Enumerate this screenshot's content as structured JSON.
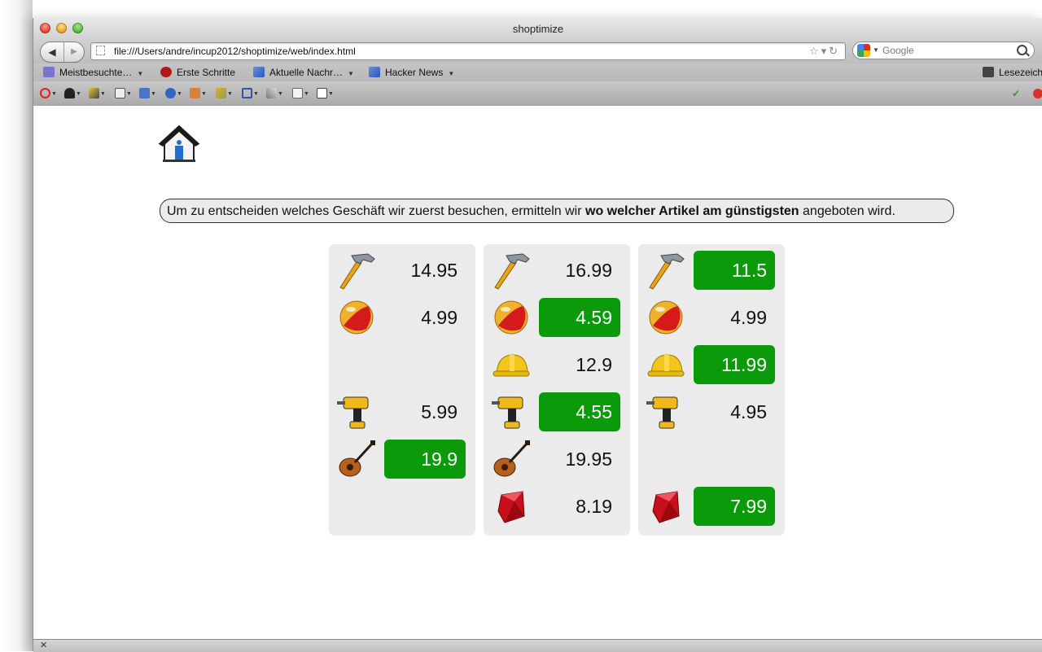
{
  "window": {
    "title": "shoptimize"
  },
  "nav": {
    "url": "file:///Users/andre/incup2012/shoptimize/web/index.html",
    "search_placeholder": "Google"
  },
  "bookmarks": [
    {
      "label": "Meistbesuchte…",
      "icon": "star-folder-icon"
    },
    {
      "label": "Erste Schritte",
      "icon": "firefox-icon"
    },
    {
      "label": "Aktuelle Nachr…",
      "icon": "rss-icon"
    },
    {
      "label": "Hacker News",
      "icon": "rss-icon"
    },
    {
      "label": "Lesezeich",
      "icon": "bookmarks-icon"
    }
  ],
  "page": {
    "info_prefix": "Um zu entscheiden welches Geschäft wir zuerst besuchen, ermitteln wir ",
    "info_bold": "wo welcher Artikel am günstigsten",
    "info_suffix": " angeboten wird."
  },
  "stores": [
    {
      "rows": [
        {
          "icon": "hammer",
          "price": "14.95",
          "best": false
        },
        {
          "icon": "ball",
          "price": "4.99",
          "best": false
        },
        {
          "icon": "",
          "price": "",
          "best": false
        },
        {
          "icon": "drill",
          "price": "5.99",
          "best": false
        },
        {
          "icon": "guitar",
          "price": "19.9",
          "best": true
        },
        {
          "icon": "",
          "price": "",
          "best": false
        }
      ]
    },
    {
      "rows": [
        {
          "icon": "hammer",
          "price": "16.99",
          "best": false
        },
        {
          "icon": "ball",
          "price": "4.59",
          "best": true
        },
        {
          "icon": "helmet",
          "price": "12.9",
          "best": false
        },
        {
          "icon": "drill",
          "price": "4.55",
          "best": true
        },
        {
          "icon": "guitar",
          "price": "19.95",
          "best": false
        },
        {
          "icon": "ruby",
          "price": "8.19",
          "best": false
        }
      ]
    },
    {
      "rows": [
        {
          "icon": "hammer",
          "price": "11.5",
          "best": true
        },
        {
          "icon": "ball",
          "price": "4.99",
          "best": false
        },
        {
          "icon": "helmet",
          "price": "11.99",
          "best": true
        },
        {
          "icon": "drill",
          "price": "4.95",
          "best": false
        },
        {
          "icon": "",
          "price": "",
          "best": false
        },
        {
          "icon": "ruby",
          "price": "7.99",
          "best": true
        }
      ]
    }
  ],
  "colors": {
    "best_price_bg": "#0a9a0a",
    "panel_bg": "#ebebeb"
  }
}
